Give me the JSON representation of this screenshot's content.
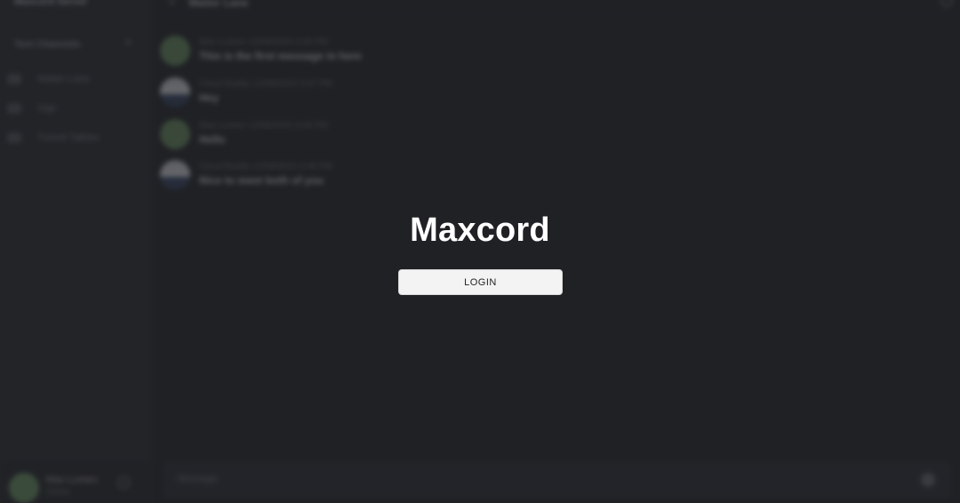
{
  "app": {
    "name": "Maxcord"
  },
  "login": {
    "button_label": "LOGIN"
  },
  "background": {
    "sidebar": {
      "workspace": "Maxcord Server",
      "section_title": "Text Channels",
      "channels": [
        "Waiter Lane",
        "Sigs",
        "Tunnel Talkies"
      ],
      "user": {
        "name": "Max Lumen",
        "status": "Online"
      }
    },
    "header": {
      "channel": "Waiter Lane"
    },
    "messages": [
      {
        "meta": "Max Lumen  12/08/2023 3:46 PM",
        "text": "This is the first message in here",
        "avatar": "green"
      },
      {
        "meta": "Cloud Buddy  12/08/2023 3:47 PM",
        "text": "Hey",
        "avatar": "cloud"
      },
      {
        "meta": "Max Lumen  12/08/2023 3:48 PM",
        "text": "Hello",
        "avatar": "green"
      },
      {
        "meta": "Cloud Buddy  12/08/2023 3:49 PM",
        "text": "Nice to meet both of you",
        "avatar": "cloud"
      }
    ],
    "composer": {
      "placeholder": "Message"
    }
  },
  "colors": {
    "background": "#222427",
    "sidebar": "#2a2c30",
    "button": "#f3f3f3",
    "title": "#ffffff"
  }
}
